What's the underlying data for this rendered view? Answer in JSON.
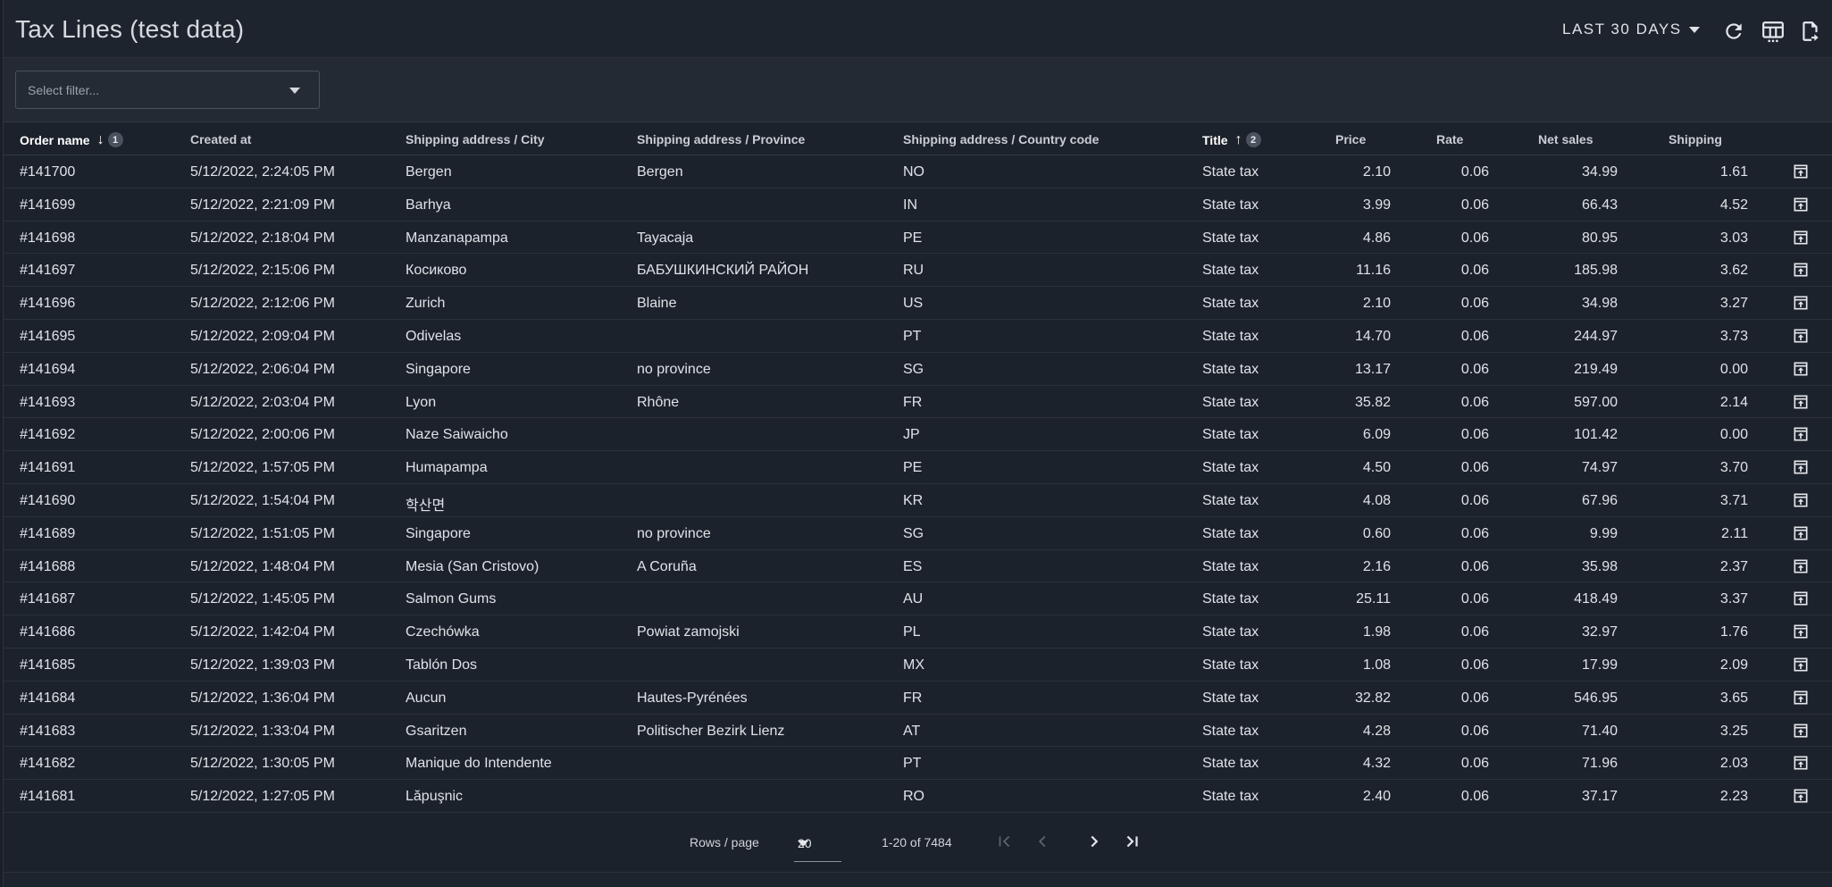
{
  "header": {
    "title": "Tax Lines (test data)",
    "range_label": "LAST 30 DAYS",
    "icons": [
      "refresh-icon",
      "table-columns-icon",
      "export-file-icon"
    ]
  },
  "filter": {
    "placeholder": "Select filter..."
  },
  "columns": [
    {
      "label": "Order name",
      "sort": "desc",
      "sort_order": "1"
    },
    {
      "label": "Created at"
    },
    {
      "label": "Shipping address / City"
    },
    {
      "label": "Shipping address / Province"
    },
    {
      "label": "Shipping address / Country code"
    },
    {
      "label": "Title",
      "sort": "asc",
      "sort_order": "2"
    },
    {
      "label": "Price"
    },
    {
      "label": "Rate"
    },
    {
      "label": "Net sales"
    },
    {
      "label": "Shipping"
    }
  ],
  "rows": [
    [
      "#141700",
      "5/12/2022, 2:24:05 PM",
      "Bergen",
      "Bergen",
      "NO",
      "State tax",
      "2.10",
      "0.06",
      "34.99",
      "1.61"
    ],
    [
      "#141699",
      "5/12/2022, 2:21:09 PM",
      "Barhya",
      "",
      "IN",
      "State tax",
      "3.99",
      "0.06",
      "66.43",
      "4.52"
    ],
    [
      "#141698",
      "5/12/2022, 2:18:04 PM",
      "Manzanapampa",
      "Tayacaja",
      "PE",
      "State tax",
      "4.86",
      "0.06",
      "80.95",
      "3.03"
    ],
    [
      "#141697",
      "5/12/2022, 2:15:06 PM",
      "Косиково",
      "БАБУШКИНСКИЙ РАЙОН",
      "RU",
      "State tax",
      "11.16",
      "0.06",
      "185.98",
      "3.62"
    ],
    [
      "#141696",
      "5/12/2022, 2:12:06 PM",
      "Zurich",
      "Blaine",
      "US",
      "State tax",
      "2.10",
      "0.06",
      "34.98",
      "3.27"
    ],
    [
      "#141695",
      "5/12/2022, 2:09:04 PM",
      "Odivelas",
      "",
      "PT",
      "State tax",
      "14.70",
      "0.06",
      "244.97",
      "3.73"
    ],
    [
      "#141694",
      "5/12/2022, 2:06:04 PM",
      "Singapore",
      "no province",
      "SG",
      "State tax",
      "13.17",
      "0.06",
      "219.49",
      "0.00"
    ],
    [
      "#141693",
      "5/12/2022, 2:03:04 PM",
      "Lyon",
      "Rhône",
      "FR",
      "State tax",
      "35.82",
      "0.06",
      "597.00",
      "2.14"
    ],
    [
      "#141692",
      "5/12/2022, 2:00:06 PM",
      "Naze Saiwaicho",
      "",
      "JP",
      "State tax",
      "6.09",
      "0.06",
      "101.42",
      "0.00"
    ],
    [
      "#141691",
      "5/12/2022, 1:57:05 PM",
      "Humapampa",
      "",
      "PE",
      "State tax",
      "4.50",
      "0.06",
      "74.97",
      "3.70"
    ],
    [
      "#141690",
      "5/12/2022, 1:54:04 PM",
      "학산면",
      "",
      "KR",
      "State tax",
      "4.08",
      "0.06",
      "67.96",
      "3.71"
    ],
    [
      "#141689",
      "5/12/2022, 1:51:05 PM",
      "Singapore",
      "no province",
      "SG",
      "State tax",
      "0.60",
      "0.06",
      "9.99",
      "2.11"
    ],
    [
      "#141688",
      "5/12/2022, 1:48:04 PM",
      "Mesia (San Cristovo)",
      "A Coruña",
      "ES",
      "State tax",
      "2.16",
      "0.06",
      "35.98",
      "2.37"
    ],
    [
      "#141687",
      "5/12/2022, 1:45:05 PM",
      "Salmon Gums",
      "",
      "AU",
      "State tax",
      "25.11",
      "0.06",
      "418.49",
      "3.37"
    ],
    [
      "#141686",
      "5/12/2022, 1:42:04 PM",
      "Czechówka",
      "Powiat zamojski",
      "PL",
      "State tax",
      "1.98",
      "0.06",
      "32.97",
      "1.76"
    ],
    [
      "#141685",
      "5/12/2022, 1:39:03 PM",
      "Tablón Dos",
      "",
      "MX",
      "State tax",
      "1.08",
      "0.06",
      "17.99",
      "2.09"
    ],
    [
      "#141684",
      "5/12/2022, 1:36:04 PM",
      "Aucun",
      "Hautes-Pyrénées",
      "FR",
      "State tax",
      "32.82",
      "0.06",
      "546.95",
      "3.65"
    ],
    [
      "#141683",
      "5/12/2022, 1:33:04 PM",
      "Gsaritzen",
      "Politischer Bezirk Lienz",
      "AT",
      "State tax",
      "4.28",
      "0.06",
      "71.40",
      "3.25"
    ],
    [
      "#141682",
      "5/12/2022, 1:30:05 PM",
      "Manique do Intendente",
      "",
      "PT",
      "State tax",
      "4.32",
      "0.06",
      "71.96",
      "2.03"
    ],
    [
      "#141681",
      "5/12/2022, 1:27:05 PM",
      "Lăpuşnic",
      "",
      "RO",
      "State tax",
      "2.40",
      "0.06",
      "37.17",
      "2.23"
    ]
  ],
  "pagination": {
    "rows_per_page_label": "Rows / page",
    "rows_per_page": "20",
    "range_text": "1-20 of 7484"
  }
}
